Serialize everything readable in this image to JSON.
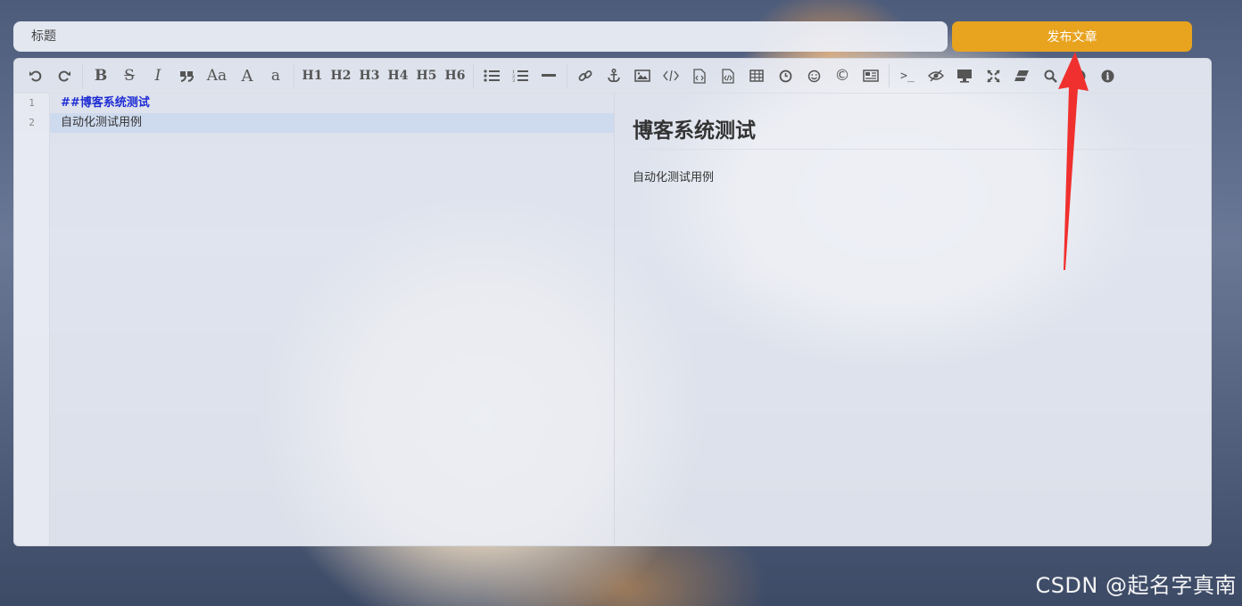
{
  "header": {
    "title_placeholder": "标题",
    "publish_label": "发布文章"
  },
  "toolbar": {
    "text_items": {
      "bold": "B",
      "strikethrough": "S",
      "italic": "I",
      "case_toggle": "Aa",
      "uppercase": "A",
      "lowercase": "a",
      "h1": "H1",
      "h2": "H2",
      "h3": "H3",
      "h4": "H4",
      "h5": "H5",
      "h6": "H6",
      "copyright": "©",
      "terminal": ">_"
    },
    "icons": [
      "undo-icon",
      "redo-icon",
      "bold-icon",
      "strikethrough-icon",
      "italic-icon",
      "quote-icon",
      "case-toggle-icon",
      "uppercase-icon",
      "lowercase-icon",
      "h1-icon",
      "h2-icon",
      "h3-icon",
      "h4-icon",
      "h5-icon",
      "h6-icon",
      "unordered-list-icon",
      "ordered-list-icon",
      "horizontal-rule-icon",
      "link-icon",
      "anchor-icon",
      "image-icon",
      "inline-code-icon",
      "code-block-icon",
      "preformatted-icon",
      "table-icon",
      "datetime-icon",
      "emoji-icon",
      "html-entity-icon",
      "page-break-icon",
      "goto-line-icon",
      "toggle-watch-icon",
      "preview-icon",
      "fullscreen-icon",
      "clear-icon",
      "search-icon",
      "help-icon",
      "info-icon"
    ]
  },
  "editor": {
    "line_numbers": [
      "1",
      "2"
    ],
    "lines": [
      "##博客系统测试",
      "自动化测试用例"
    ]
  },
  "preview": {
    "heading": "博客系统测试",
    "paragraph": "自动化测试用例"
  },
  "watermark": "CSDN @起名字真南",
  "colors": {
    "publish_button": "#e8a31f",
    "heading_markdown": "#1f2dd4",
    "arrow": "#f0302e"
  }
}
